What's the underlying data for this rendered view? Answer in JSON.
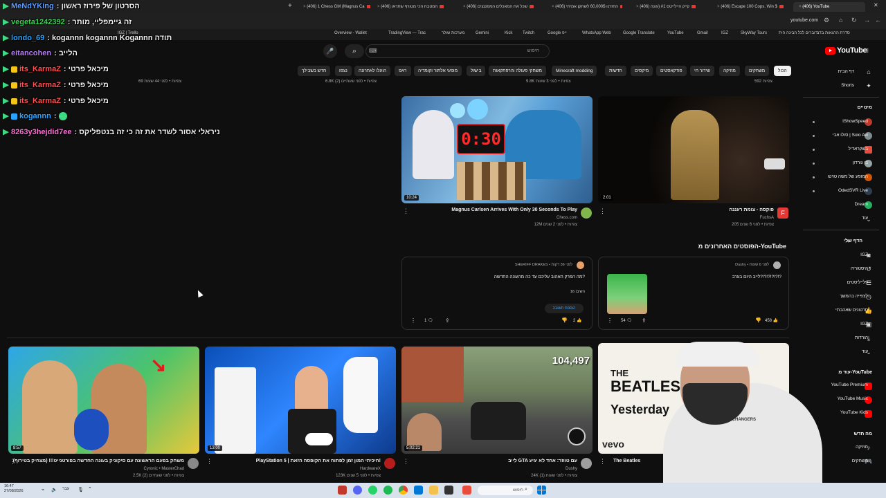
{
  "browser": {
    "tabs": [
      {
        "label": "(406) 1 Chess GM (Magnus Ca"
      },
      {
        "label": "(406) המטבח הכי מטורף שתראו"
      },
      {
        "label": "(406) שכל את המאכלים המפוצצים"
      },
      {
        "label": "(406) החזרנו 60,000$ לשחקן אמיתי"
      },
      {
        "label": "(406) קייק היילייטס #1 (עונה"
      },
      {
        "label": "(406) Escape 100 Cops, Win $"
      },
      {
        "label": "(406) YouTube"
      }
    ],
    "url": "youtube.com",
    "bookmarks": [
      "סדרת הרצאות בדב",
      "דוברים לכל הבינה הית",
      "IGZ | Trello",
      "Overview - Wallet",
      "TradingView — Trac",
      "מערכות שולר",
      "Gemini",
      "Kick",
      "Twitch",
      "Google ייפ",
      "WhatsApp Web",
      "Google Translate",
      "YouTube",
      "Gmail",
      "IGZ",
      "SkyWay Tours"
    ]
  },
  "youtube": {
    "logo": "YouTube",
    "search_placeholder": "חיפוש",
    "chips": [
      "הכול",
      "משחקים",
      "מוזיקה",
      "שידור חי",
      "פודקאסטים",
      "מיקסים",
      "חדשות",
      "Minecraft modding",
      "משחקי פעולה והרפתקאות",
      "בישול",
      "מופעי אלתור וקומדיה",
      "ראפ",
      "הועלו לאחרונה",
      "נצפו",
      "חדש בשבילך"
    ],
    "sidebar": {
      "main": [
        "דף הבית",
        "Shorts"
      ],
      "subs_header": "מינויים",
      "subs": [
        "IShowSpeed",
        "סולו אבי | Solo Avi",
        "בשקראדיל",
        "בן גורדון",
        "המופע של משה טויטו",
        "OdedSVR Live",
        "Dream",
        "עוד"
      ],
      "you_header": "הדף שלי",
      "you": [
        "IGZ",
        "היסטוריה",
        "פלייליסטים",
        "לצפייה בהמשך",
        "סרטונים שאהבתי",
        "IGZ",
        "הורדות",
        "עוד"
      ],
      "more_header": "עוד מ-YouTube",
      "more": [
        "YouTube Premium",
        "YouTube Music",
        "YouTube Kids"
      ],
      "explore_header": "מה חדש",
      "explore": [
        "מוזיקה",
        "משחקים"
      ]
    },
    "top_meta": {
      "left": "69 צפיות • לפני 44 שעות",
      "mid": "6.8K צפיות • לפני שעתיים (2)",
      "right": "9.8K צפיות • לפני 3 שעות",
      "far": "592 צפיות"
    },
    "videos_row1": [
      {
        "title": "Magnus Carlsen Arrives With Only 30 Seconds To Play",
        "channel": "Chess.com",
        "meta": "12M צפיות • לפני 2 שנים",
        "duration": "10:24"
      },
      {
        "title": "פוקסה - צומת רעננה",
        "channel": "FuchsA",
        "meta": "205 צפיות • לפני 6 שנים",
        "duration": "2:01"
      }
    ],
    "posts_header": "הפוסטים האחרונים מ-YouTube",
    "posts": [
      {
        "author": "SHERIFF DRAKES",
        "time": "לפני 36 דקות",
        "text": "מה הפרק האהוב עליכם עד כה מהעונה החדשה?",
        "replies": "16 השיבו",
        "reply_btn": "הוספת תשובה",
        "likes": "2",
        "comments": "1"
      },
      {
        "author": "Dushy",
        "time": "לפני 6 שעות",
        "text": "לייב היום בערב?!?!?!?!?!?",
        "likes": "458",
        "comments": "54"
      }
    ],
    "videos_row2": [
      {
        "title": "משחק בפעם הראשונה עם סיקוניק בעונה החדשה בפורטנייט!!! (מצחיק בטירוף)",
        "channel": "Cyronic • MasterChad",
        "meta": "2.5K צפיות • לפני שעתיים (2)",
        "duration": "8:57"
      },
      {
        "title": "PlayStation 5 | חיכיתי המון זמן לפתוח את הקופסה הזאת!",
        "channel": "HardwareX",
        "meta": "123K צפיות • לפני 5 שנים",
        "duration": "13:00"
      },
      {
        "title": "לייב GTA עם טווזר: אחד לא יגיע",
        "channel": "Dushy",
        "meta": "24K צפיות • לפני שעות (1)",
        "duration": "5:02:21",
        "thumb_number": "104,497"
      },
      {
        "title": "The Beatles",
        "channel": "",
        "meta": "",
        "duration": "",
        "thumb_text1": "THE",
        "thumb_text2": "BEATLES",
        "thumb_text3": "Yesterday",
        "thumb_text4": "vevo"
      }
    ]
  },
  "chat": [
    {
      "user": "MeNdYKing",
      "text": ": הסרטון של פירוז ראשון",
      "color": "#5b9bff"
    },
    {
      "user": "vegeta1242392",
      "text": ": זה גיימפליי, מותר",
      "color": "#39d353"
    },
    {
      "user": "londo_69",
      "text": ": kogannn kogannn Kogannn תודה",
      "color": "#29a3ff"
    },
    {
      "user": "eitancohen",
      "text": ": הלייב",
      "color": "#b57cf3"
    },
    {
      "user": "its_KarmaZ",
      "text": ": מיכאל פרטי",
      "color": "#ff4f4f"
    },
    {
      "user": "its_KarmaZ",
      "text": ": מיכאל פרטי",
      "color": "#ff4f4f"
    },
    {
      "user": "its_KarmaZ",
      "text": ": מיכאל פרטי",
      "color": "#ff4f4f"
    },
    {
      "user": "kogannn",
      "text": ":",
      "color": "#29a3ff"
    },
    {
      "user": "8263y3hejdid7ee",
      "text": ": ניראלי אסור לשדר את זה כי זה בנטפליקס",
      "color": "#ff6fd8"
    }
  ],
  "taskbar": {
    "time": "16:47",
    "date": "27/08/2026",
    "search": "חיפוש",
    "lang": "עבר"
  },
  "cam_shirt": "GAME CHANGERS"
}
